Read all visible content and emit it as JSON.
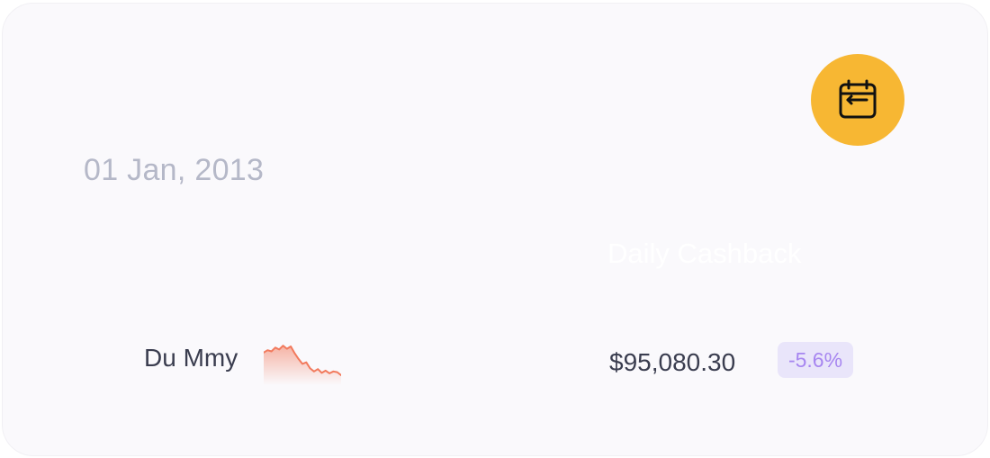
{
  "card": {
    "date": "01 Jan, 2013",
    "caption": "Daily Cashback",
    "name": "Du Mmy",
    "amount": "$95,080.30",
    "change": "-5.6%",
    "icon": "calendar-icon",
    "trend": [
      0.72,
      0.78,
      0.75,
      0.85,
      0.8,
      0.9,
      0.82,
      0.88,
      0.7,
      0.55,
      0.42,
      0.46,
      0.3,
      0.22,
      0.28,
      0.18,
      0.24,
      0.17,
      0.22,
      0.2,
      0.12
    ]
  },
  "colors": {
    "accent": "#f7b733",
    "trend": "#f27a5d",
    "badge_bg": "#e9e5fa",
    "badge_text": "#a786f0",
    "muted_text": "#b5b8c8",
    "primary_text": "#3a3d4f"
  }
}
